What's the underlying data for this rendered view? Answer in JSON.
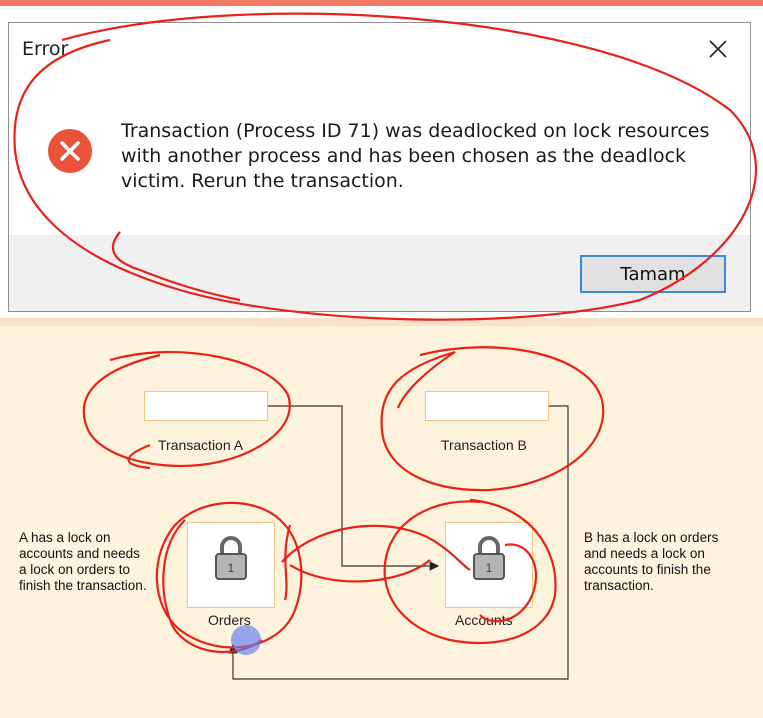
{
  "dialog": {
    "title": "Error",
    "message": "Transaction (Process ID 71) was deadlocked on lock resources with another process and has been chosen as the deadlock victim. Rerun the transaction.",
    "ok_label": "Tamam"
  },
  "diagram": {
    "transaction_a": "Transaction A",
    "transaction_b": "Transaction B",
    "resource_left": "Orders",
    "resource_right": "Accounts",
    "lock_digit": "1",
    "note_left": "A has a lock on\naccounts and needs\na lock on orders to\nfinish the transaction.",
    "note_right": "B has a lock on orders\nand needs a lock on\naccounts to finish the\ntransaction."
  },
  "colors": {
    "error_red": "#e8533a",
    "annotation_red": "#e8211a",
    "accent_blue": "#3c8ad8",
    "panel_bg": "#fdf3dd"
  }
}
